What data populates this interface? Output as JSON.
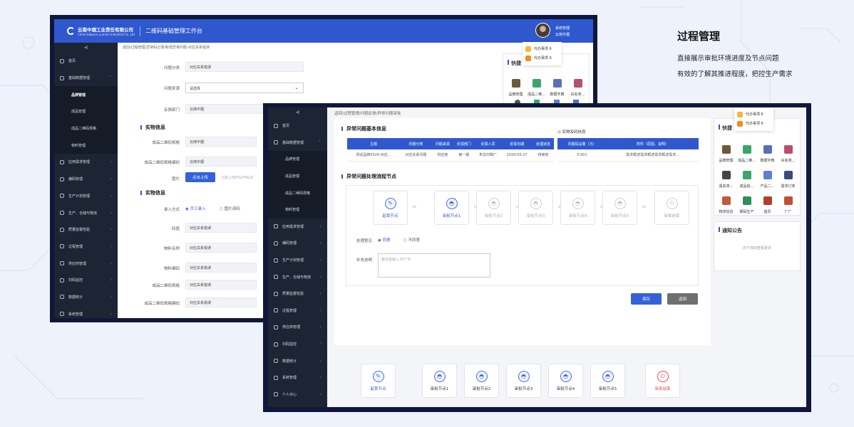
{
  "panel": {
    "title": "过程管理",
    "lines": [
      "直接展示审批环境进度及节点问题",
      "有效的了解其推进程度，把控生产需求"
    ]
  },
  "app": {
    "logo_cn": "云南中烟工业责任有限公司",
    "logo_en": "China tobacco yunnan industrial Co.,Ltd",
    "system_title": "二维码基础管理工作台",
    "user_role": "系统管理",
    "user_org": "云南中烟",
    "collapse_glyph": "◂‖"
  },
  "back_sidebar": [
    {
      "label": "首页",
      "icon": "home-icon"
    },
    {
      "label": "基础数据管理",
      "icon": "database-icon",
      "open": true
    },
    {
      "label": "品牌管理",
      "sub": true,
      "active": true
    },
    {
      "label": "成品管理",
      "sub": true
    },
    {
      "label": "成品二维码规格",
      "sub": true
    },
    {
      "label": "物料管理",
      "sub": true
    },
    {
      "label": "应用需求管理",
      "icon": "cube-icon"
    },
    {
      "label": "编码管理",
      "icon": "code-icon"
    },
    {
      "label": "生产计划管理",
      "icon": "calendar-icon"
    },
    {
      "label": "生产、仓储与物流",
      "icon": "truck-icon"
    },
    {
      "label": "质量监督检验",
      "icon": "quality-icon"
    },
    {
      "label": "过程管理",
      "icon": "process-icon"
    },
    {
      "label": "供应商管理",
      "icon": "supplier-icon"
    },
    {
      "label": "扫码监控",
      "icon": "scan-icon"
    },
    {
      "label": "数据统计",
      "icon": "stats-icon"
    },
    {
      "label": "系统管理",
      "icon": "settings-icon"
    }
  ],
  "front_sidebar": [
    {
      "label": "首页",
      "icon": "home-icon"
    },
    {
      "label": "基础数据管理",
      "icon": "database-icon",
      "open": true
    },
    {
      "label": "品牌管理",
      "sub": true
    },
    {
      "label": "成品管理",
      "sub": true
    },
    {
      "label": "成品二维码规格",
      "sub": true
    },
    {
      "label": "物料管理",
      "sub": true
    },
    {
      "label": "应用需求管理",
      "icon": "cube-icon"
    },
    {
      "label": "编码管理",
      "icon": "code-icon"
    },
    {
      "label": "生产计划管理",
      "icon": "calendar-icon"
    },
    {
      "label": "生产、仓储与物流",
      "icon": "truck-icon"
    },
    {
      "label": "质量监督检验",
      "icon": "quality-icon"
    },
    {
      "label": "过程管理",
      "icon": "process-icon"
    },
    {
      "label": "供应商管理",
      "icon": "supplier-icon"
    },
    {
      "label": "扫码监控",
      "icon": "scan-icon"
    },
    {
      "label": "数据统计",
      "icon": "stats-icon"
    },
    {
      "label": "系统管理",
      "icon": "settings-icon"
    },
    {
      "label": "个人中心",
      "icon": "user-icon"
    }
  ],
  "back": {
    "breadcrumb": "返回/过程管理/异常码记录/新增异常问题-对应关系错误",
    "f_type_label": "问题分类",
    "f_type_value": "对应关系错误",
    "f_source_label": "问题来源",
    "f_source_value": "请选择",
    "f_dept_label": "反馈部门",
    "f_dept_value": "云南中烟",
    "sec1": "实物信息",
    "f_spec_label": "成品二维码规格",
    "f_spec_value": "云南中烟",
    "f_specno_label": "成品二维码规格编码",
    "f_specno_value": "云南中烟",
    "f_img_label": "图片",
    "f_img_button": "点击上传",
    "f_img_hint": "只能上传JPG/PNG文",
    "sec2": "实物信息",
    "f_mode_label": "录入方式",
    "f_mode_opt1": "手工录入",
    "f_mode_opt2": "图片读码",
    "f_code_label": "码值",
    "f_code_value": "对应关系错误",
    "f_mat_label": "物料名称",
    "f_mat_value": "对应关系错误",
    "f_matno_label": "物料编码",
    "f_matno_value": "对应关系错误",
    "f_spec2_label": "成品二维码规格",
    "f_spec2_value": "对应关系错误",
    "f_spec2no_label": "成品二维码规格编码",
    "f_spec2no_value": "对应关系错误",
    "quick_title": "快捷",
    "quick": [
      {
        "label": "品牌管理",
        "icon": "crown-icon"
      },
      {
        "label": "成品二维...",
        "icon": "qr-icon"
      },
      {
        "label": "数据字典",
        "icon": "book-icon"
      },
      {
        "label": "白名单...",
        "icon": "user-check-icon"
      }
    ]
  },
  "todo": [
    {
      "label": "代办事项",
      "count": "6"
    },
    {
      "label": "代办事项",
      "count": "6"
    }
  ],
  "front": {
    "breadcrumb": "返回/过程管理/问题反馈/异常问题审批",
    "sec_basic": "异常问题基本信息",
    "basic_headers": [
      "主题",
      "问题分类",
      "问题来源",
      "反馈部门",
      "反馈人员",
      "反馈日期",
      "处理状态"
    ],
    "basic_row": [
      "测试品牌0526-对应...",
      "对应关系问题",
      "供应商",
      "第一版",
      "朱氏印刷厂",
      "2020-05-27",
      "待审核"
    ],
    "sec_material": "实物及码信息",
    "material_headers": [
      "问题码总量（万）",
      "附件（原因、说明）"
    ],
    "material_row": [
      "0.001",
      "需求概述需求概述需求概述需求..."
    ],
    "sec_flow": "异常问题处理流程节点",
    "flow_nodes": [
      "起草节点",
      "审批节点1",
      "审批节点2",
      "审批节点3",
      "审批节点4",
      "审批节点5",
      "审批结束"
    ],
    "opinion_label": "处理意见",
    "opt_agree": "同意",
    "opt_disagree": "不同意",
    "note_label": "补充说明",
    "note_placeholder": "最多能输入30个字",
    "save_button": "保存",
    "back_button": "返回",
    "quick_title": "快捷",
    "quick": [
      {
        "label": "品牌管理",
        "icon": "crown-icon"
      },
      {
        "label": "成品二维...",
        "icon": "qr-icon"
      },
      {
        "label": "数据字典",
        "icon": "book-icon"
      },
      {
        "label": "白名单...",
        "icon": "user-check-icon"
      },
      {
        "label": "黑名单...",
        "icon": "user-block-icon"
      },
      {
        "label": "成品追...",
        "icon": "search-icon"
      },
      {
        "label": "产品二...",
        "icon": "calendar-check-icon"
      },
      {
        "label": "需求订单",
        "icon": "clipboard-icon"
      },
      {
        "label": "物流信息",
        "icon": "truck-icon"
      },
      {
        "label": "赋码生产",
        "icon": "barcode-icon"
      },
      {
        "label": "首页",
        "icon": "home-icon"
      },
      {
        "label": "厂厂",
        "icon": "factory-icon"
      }
    ],
    "notice_title": "通知公告",
    "notice_hint": "向下滑动查看更多"
  },
  "bottom_flow": [
    "起草节点",
    "审批节点1",
    "审批节点2",
    "审批节点3",
    "审批节点4",
    "审批节点5",
    "审批结束"
  ],
  "colors": {
    "primary": "#2f58cf",
    "sidebar": "#1d2433",
    "frame": "#10183a",
    "danger": "#e24b4b",
    "save": "#3462d8",
    "back": "#6f6f6f"
  }
}
